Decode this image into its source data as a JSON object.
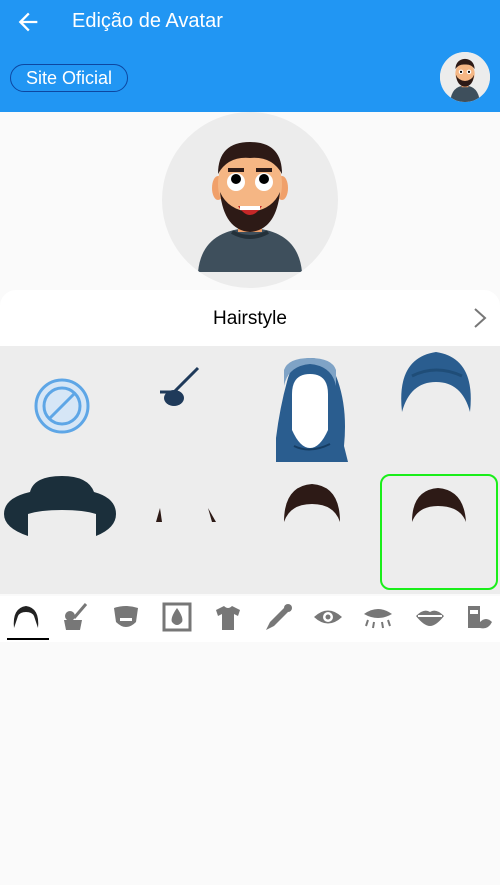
{
  "appbar": {
    "title": "Edição de Avatar",
    "site_button": "Site Oficial"
  },
  "section": {
    "title": "Hairstyle"
  },
  "grid": {
    "items": [
      "none",
      "eyepatch",
      "hijab",
      "turban",
      "wide-brim-hat",
      "thin-hair",
      "short-hair",
      "short-hair-selected"
    ],
    "selected_index": 7
  },
  "tabs": {
    "items": [
      "hairstyle",
      "hair-color",
      "facial-hair",
      "skin-tone",
      "clothing",
      "clothing-color",
      "eyes",
      "eyebrows",
      "mouth",
      "accessories"
    ],
    "active_index": 0
  },
  "colors": {
    "primary": "#2196f3",
    "selection": "#1aee1a",
    "navy": "#1f3a5a",
    "hair": "#2d1a16"
  }
}
